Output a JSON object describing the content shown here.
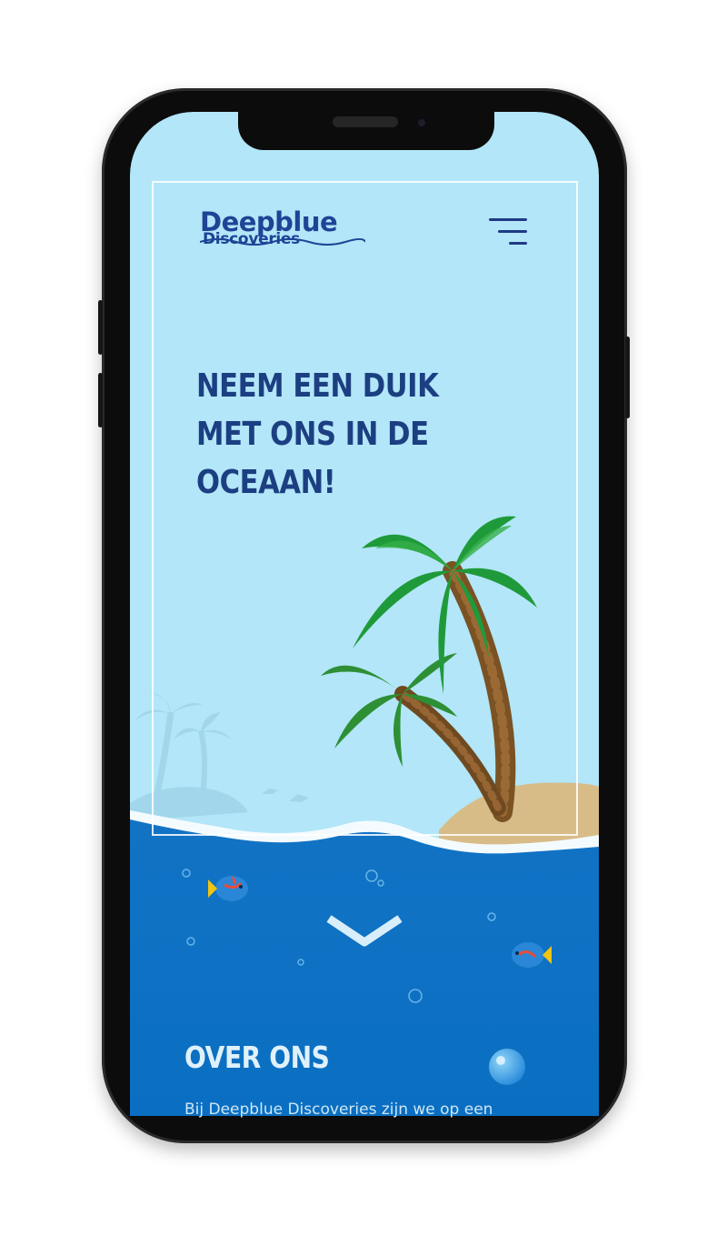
{
  "header": {
    "logo_line1": "Deepblue",
    "logo_line2": "Discoveries",
    "menu_icon": "hamburger-menu-icon"
  },
  "hero": {
    "title": "NEEM EEN DUIK MET ONS IN DE OCEAAN!",
    "scroll_icon": "chevron-down-icon"
  },
  "about": {
    "title": "OVER ONS",
    "text": "Bij Deepblue Discoveries zijn we op een"
  },
  "colors": {
    "sky": "#b2e6f8",
    "ocean": "#0a74c6",
    "brand_navy": "#1c3f82",
    "sand": "#d8bc88",
    "phone_body": "#0c0c0c"
  }
}
